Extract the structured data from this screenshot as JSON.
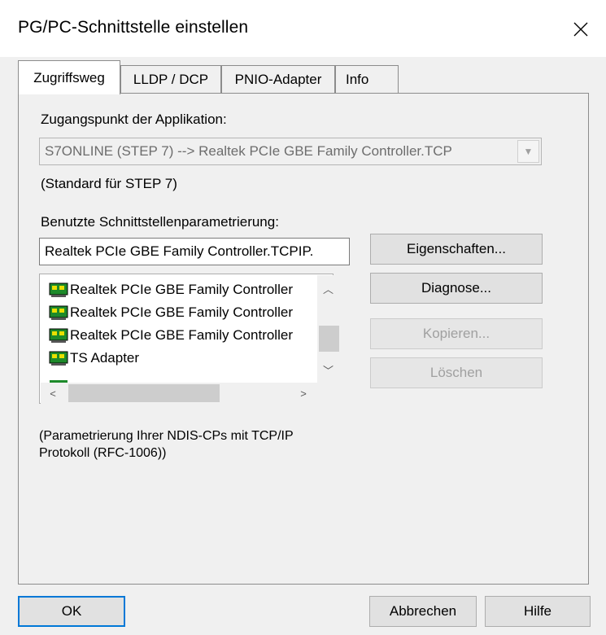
{
  "window": {
    "title": "PG/PC-Schnittstelle einstellen",
    "close_icon": "close-icon"
  },
  "tabs": [
    {
      "label": "Zugriffsweg",
      "active": true
    },
    {
      "label": "LLDP / DCP",
      "active": false
    },
    {
      "label": "PNIO-Adapter",
      "active": false
    },
    {
      "label": "Info",
      "active": false
    }
  ],
  "access_point": {
    "label": "Zugangspunkt der Applikation:",
    "value": "S7ONLINE (STEP 7)     --> Realtek PCIe GBE Family Controller.TCP",
    "note": "(Standard für STEP 7)"
  },
  "interface_params": {
    "label": "Benutzte Schnittstellenparametrierung:",
    "value": "Realtek PCIe GBE Family Controller.TCPIP.",
    "items": [
      "Realtek PCIe GBE Family Controller",
      "Realtek PCIe GBE Family Controller",
      "Realtek PCIe GBE Family Controller",
      "TS Adapter"
    ],
    "description_line1": "(Parametrierung Ihrer NDIS-CPs mit TCP/IP",
    "description_line2": "Protokoll (RFC-1006))"
  },
  "side_buttons": {
    "properties": "Eigenschaften...",
    "diagnose": "Diagnose...",
    "copy": "Kopieren...",
    "delete": "Löschen"
  },
  "footer": {
    "ok": "OK",
    "cancel": "Abbrechen",
    "help": "Hilfe"
  }
}
